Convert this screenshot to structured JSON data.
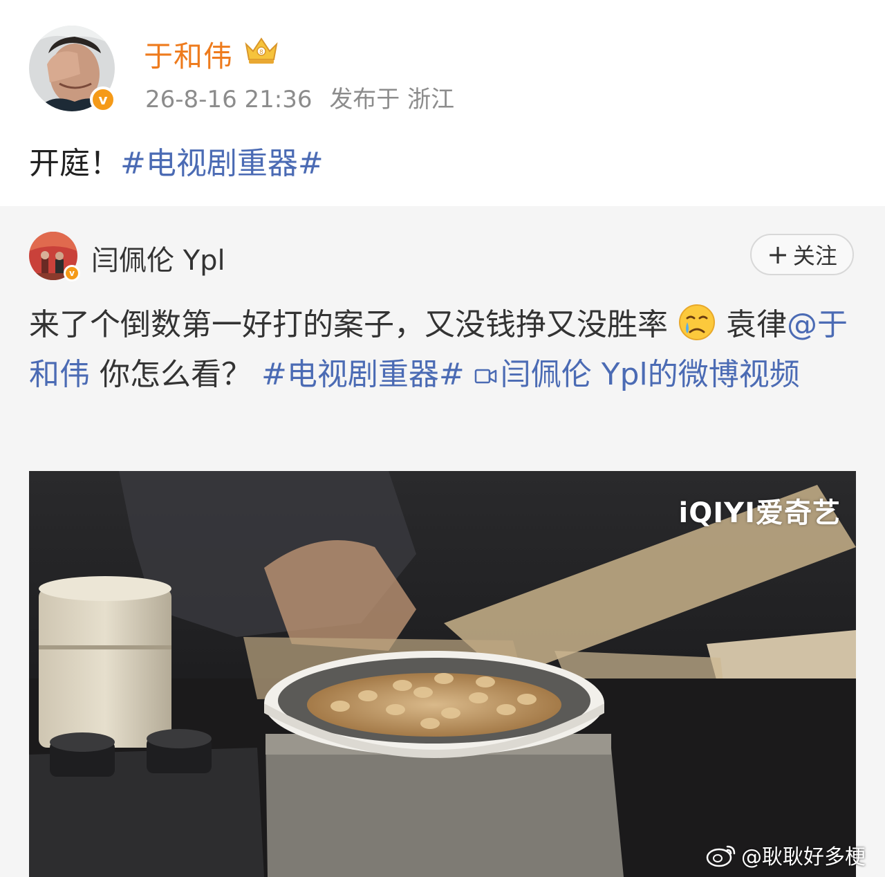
{
  "post": {
    "author_name": "于和伟",
    "timestamp": "26-8-16 21:36",
    "location": "发布于 浙江",
    "text_plain": "开庭！",
    "text_topic": "#电视剧重器#"
  },
  "repost": {
    "author_name": "闫佩伦 Ypl",
    "follow_label": "关注",
    "follow_plus": "+",
    "text_part1": "来了个倒数第一好打的案子，又没钱挣又没胜率",
    "text_part2": " 袁律",
    "mention": "@于和伟",
    "text_part3": " 你怎么看？",
    "topic": "#电视剧重器#",
    "video_link": "闫佩伦 Ypl的微博视频"
  },
  "video": {
    "logo_text": "iQIYI爱奇艺"
  },
  "watermark": {
    "text": "@耿耿好多梗"
  },
  "colors": {
    "author_orange": "#ee7b1d",
    "link_blue": "#4b6bb4",
    "verify_badge": "#f59a18",
    "meta_gray": "#8c8c8c",
    "repost_bg": "#f5f5f5"
  },
  "icons": {
    "crown": "crown-badge-icon",
    "verify": "verified-v-icon",
    "emoji": "crying-emoji-icon",
    "video_link": "video-camera-icon",
    "weibo": "weibo-logo-icon"
  }
}
